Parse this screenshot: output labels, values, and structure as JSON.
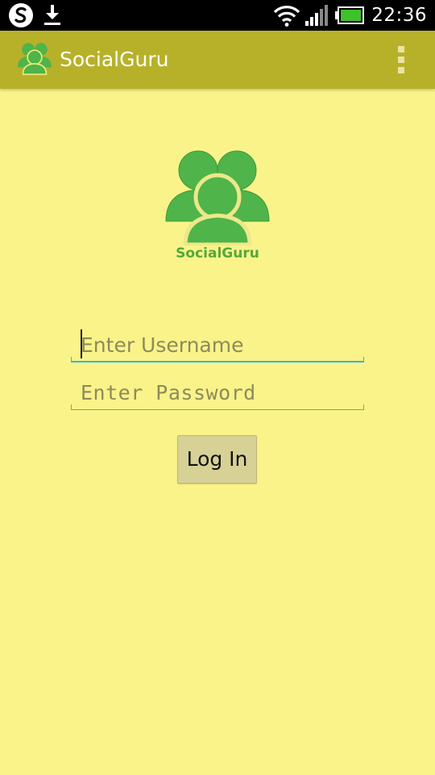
{
  "status_bar": {
    "time": "22:36",
    "icons": [
      "app-s-icon",
      "download-icon",
      "wifi-icon",
      "signal-icon",
      "battery-icon"
    ]
  },
  "action_bar": {
    "title": "SocialGuru",
    "app_icon": "people-group-icon",
    "menu_icon": "overflow-menu-icon"
  },
  "logo": {
    "text": "SocialGuru",
    "icon": "people-group-icon"
  },
  "form": {
    "username_placeholder": "Enter Username",
    "username_value": "",
    "password_placeholder": "Enter Password",
    "password_value": "",
    "login_label": "Log In"
  },
  "colors": {
    "background": "#f9f38a",
    "action_bar": "#b7b12a",
    "accent_focus": "#33b5e5",
    "logo_green": "#55b04a",
    "button": "#d7d196"
  }
}
